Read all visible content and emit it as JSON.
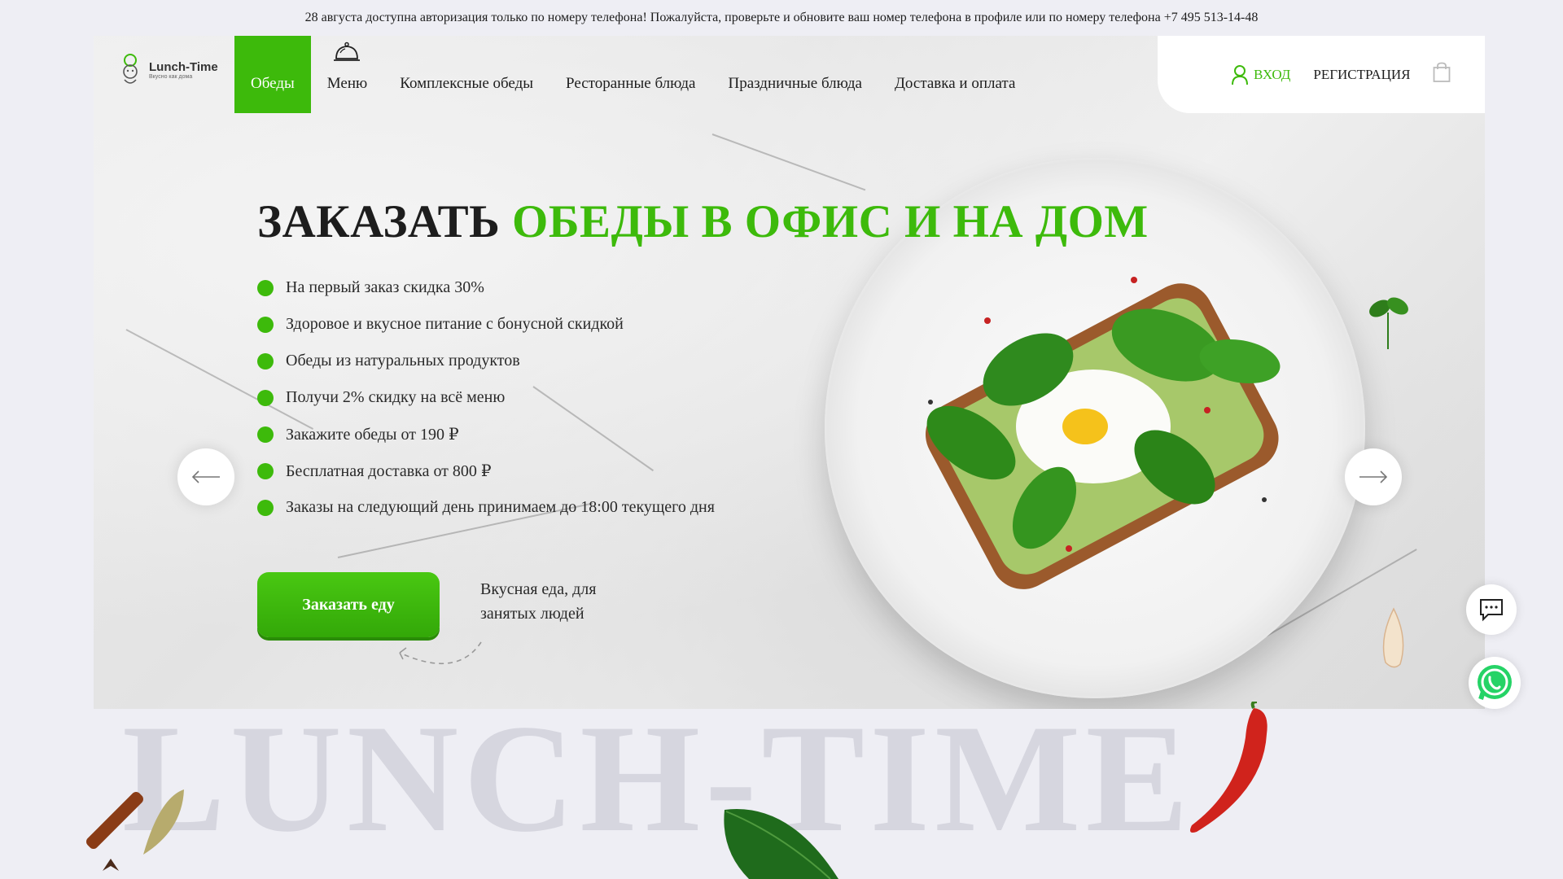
{
  "announcement": "28 августа доступна авторизация только по номеру телефона! Пожалуйста, проверьте и обновите ваш номер телефона в профиле или по номеру телефона +7 495 513-14-48",
  "logo": {
    "title": "Lunch-Time",
    "subtitle": "Вкусно как дома"
  },
  "nav": [
    {
      "label": "Обеды",
      "active": true
    },
    {
      "label": "Меню",
      "icon": "cloche-icon"
    },
    {
      "label": "Комплексные обеды"
    },
    {
      "label": "Ресторанные блюда"
    },
    {
      "label": "Праздничные блюда"
    },
    {
      "label": "Доставка и оплата"
    }
  ],
  "auth": {
    "login": "ВХОД",
    "register": "РЕГИСТРАЦИЯ",
    "cart_icon": "shopping-bag-icon"
  },
  "hero": {
    "headline_dark": "ЗАКАЗАТЬ",
    "headline_green": "ОБЕДЫ В ОФИС И НА ДОМ",
    "features": [
      "На первый заказ скидка 30%",
      "Здоровое и вкусное питание с бонусной скидкой",
      "Обеды из натуральных продуктов",
      "Получи 2% скидку на всё меню",
      "Закажите обеды от 190 ₽",
      "Бесплатная доставка от 800 ₽",
      "Заказы на следующий день принимаем до 18:00 текущего дня"
    ],
    "cta": "Заказать еду",
    "tagline": "Вкусная еда, для занятых людей"
  },
  "watermark": "LUNCH-TIME",
  "colors": {
    "accent": "#3dba0b",
    "background": "#eeeef4",
    "whatsapp": "#25d366"
  }
}
